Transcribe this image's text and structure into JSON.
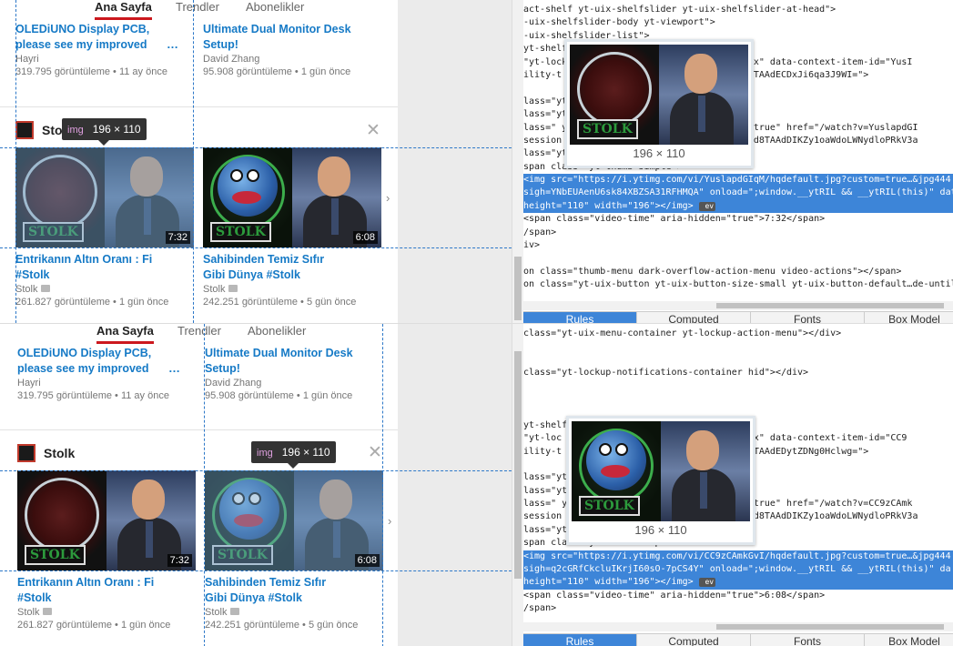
{
  "tabs": [
    "Ana Sayfa",
    "Trendler",
    "Abonelikler"
  ],
  "upper_videos": [
    {
      "title": "OLEDiUNO Display PCB, please see my improved",
      "channel": "Hayri",
      "views": "319.795 görüntüleme",
      "age": "11 ay önce"
    },
    {
      "title": "Ultimate Dual Monitor Desk Setup!",
      "channel": "David Zhang",
      "views": "95.908 görüntüleme",
      "age": "1 gün önce"
    }
  ],
  "more_glyph": "…",
  "dot": "•",
  "shelf": {
    "title": "Stolk",
    "close": "✕"
  },
  "shelf_videos": [
    {
      "title": "Entrikanın Altın Oranı : Fi #Stolk",
      "channel": "Stolk",
      "views": "261.827 görüntüleme",
      "age": "1 gün önce",
      "duration": "7:32",
      "thumb": "stolk-group"
    },
    {
      "title": "Sahibinden Temiz Sıfır Gibi Dünya #Stolk",
      "channel": "Stolk",
      "views": "242.251 görüntüleme",
      "age": "5 gün önce",
      "duration": "6:08",
      "thumb": "stolk-earth"
    }
  ],
  "thumb_logo_text": "STOLK",
  "next_arrow": "›",
  "tooltip": {
    "tag": "img",
    "size": "196 × 110"
  },
  "verified_icon": "check-badge-icon",
  "devtools": {
    "tabs": [
      "Rules",
      "Computed",
      "Fonts",
      "Box Model"
    ],
    "hover_size": "196 × 110",
    "ev_badge": "ev",
    "top_code": [
      "act-shelf yt-uix-shelfslider yt-uix-shelfslider-at-head\">",
      "-uix-shelfslider-body yt-viewport\">",
      "-uix-shelfslider-list\">",
      "yt-shelf",
      "\"yt-lock                           clearfix\" data-context-item-id=\"YusI",
      "ility-t                            rUFgod8TAAdECDxJi6qa3J9WI=\">",
      "",
      "lass=\"yt-lo",
      "lass=\"yt-",
      "lass=\" yt-                         idder=\"true\" href=\"/watch?v=YuslapdGI",
      "session                            FYrUFgod8TAAdDIKZy1oaWdoLWNydloPRkV3a",
      "lass=\"yt-",
      "span class=\"yt-thumb-simple\">",
      "<img src=\"https://i.ytimg.com/vi/YuslapdGIqM/hqdefault.jpg?custom=true…&jpg444",
      "sigh=YNbEUAenU6sk84XBZSA31RFHMQA\" onload=\";window.__ytRIL && __ytRIL(this)\" dat",
      "height=\"110\" width=\"196\"></img>",
      "<span class=\"video-time\" aria-hidden=\"true\">7:32</span>",
      "/span>",
      "iv>",
      "",
      "on class=\"thumb-menu dark-overflow-action-menu video-actions\"></span>",
      "on class=\"yt-uix-button yt-uix-button-size-small yt-uix-button-default…de-until"
    ],
    "bottom_code": [
      "class=\"yt-uix-menu-container yt-lockup-action-menu\"></div>",
      "",
      "",
      "class=\"yt-lockup-notifications-container hid\"></div>",
      "",
      "",
      "",
      "yt-shelf",
      "\"yt-loc                            clearfix\" data-context-item-id=\"CC9",
      "ility-t                            rUFgod8TAAdEDytZDNg0Hclwg=\">",
      "",
      "lass=\"yt-lo",
      "lass=\"yt-",
      "lass=\" yt                          idder=\"true\" href=\"/watch?v=CC9zCAmk",
      "session                            FYrUFgod8TAAdDIKZy1oaWdoLWNydloPRkV3a",
      "lass=\"yt-thumb-simple\">",
      "span class=\"yt-thumb-simple\">",
      "<img src=\"https://i.ytimg.com/vi/CC9zCAmkGvI/hqdefault.jpg?custom=true…&jpg444",
      "sigh=q2cGRfCkcluIKrjI60sO-7pCS4Y\" onload=\";window.__ytRIL && __ytRIL(this)\" da",
      "height=\"110\" width=\"196\"></img>",
      "<span class=\"video-time\" aria-hidden=\"true\">6:08</span>",
      "/span>"
    ]
  }
}
